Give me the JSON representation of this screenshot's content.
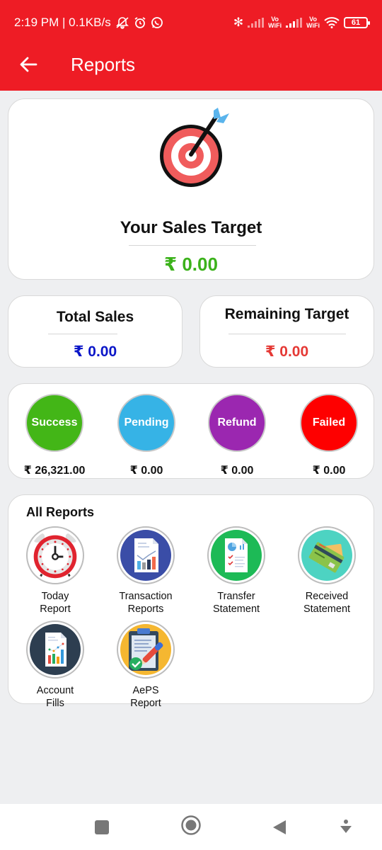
{
  "status_bar": {
    "time_speed": "2:19 PM | 0.1KB/s",
    "icons": [
      "mute-icon",
      "alarm-icon",
      "whatsapp-icon",
      "bluetooth-icon",
      "signal-icon",
      "vowifi-icon",
      "signal-icon",
      "vowifi-icon",
      "wifi-icon",
      "battery-icon"
    ],
    "vowifi_top": "Vo",
    "vowifi_bottom": "WiFi",
    "battery": "61"
  },
  "appbar": {
    "title": "Reports",
    "back_icon": "arrow-left-icon"
  },
  "colors": {
    "brand": "#ee1c25",
    "target_value": "#3cb21b",
    "total_sales_value": "#0b16c8",
    "remaining_value": "#e53935"
  },
  "sales_target": {
    "icon": "target-icon",
    "title": "Your Sales Target",
    "value": "₹ 0.00"
  },
  "total_sales": {
    "title": "Total Sales",
    "value": "₹ 0.00"
  },
  "remaining_target": {
    "title": "Remaining Target",
    "value": "₹ 0.00"
  },
  "statuses": [
    {
      "label": "Success",
      "amount": "₹ 26,321.00",
      "color": "#43b617"
    },
    {
      "label": "Pending",
      "amount": "₹ 0.00",
      "color": "#36b3e6"
    },
    {
      "label": "Refund",
      "amount": "₹ 0.00",
      "color": "#9b27b0"
    },
    {
      "label": "Failed",
      "amount": "₹ 0.00",
      "color": "#fe0000"
    }
  ],
  "all_reports": {
    "title": "All Reports",
    "items": [
      {
        "line1": "Today",
        "line2": "Report",
        "icon": "alarm-clock-icon"
      },
      {
        "line1": "Transaction",
        "line2": "Reports",
        "icon": "chart-document-icon"
      },
      {
        "line1": "Transfer",
        "line2": "Statement",
        "icon": "statement-document-icon"
      },
      {
        "line1": "Received",
        "line2": "Statement",
        "icon": "credit-card-icon"
      },
      {
        "line1": "Account",
        "line2": "Fills",
        "icon": "bar-chart-document-icon"
      },
      {
        "line1": "AePS",
        "line2": "Report",
        "icon": "clipboard-check-icon"
      }
    ]
  },
  "nav_bar": {
    "buttons": [
      "recents-icon",
      "home-icon",
      "back-icon",
      "assistant-icon"
    ]
  }
}
